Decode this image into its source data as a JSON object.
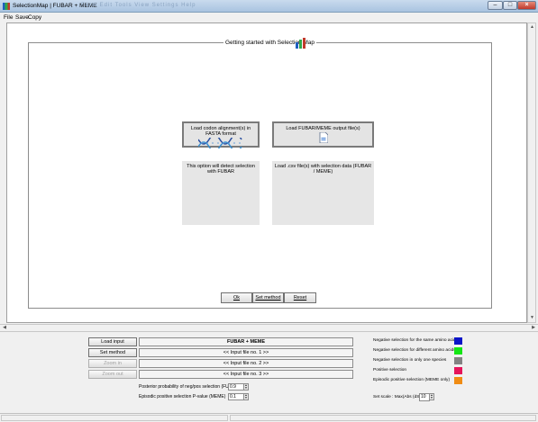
{
  "window": {
    "title": "SelectionMap  |  FUBAR + MEME",
    "ghost_menu": "Form   Edit   Tools   View   Settings   Help"
  },
  "menu": [
    "File",
    "Save",
    "Copy"
  ],
  "main": {
    "group_title": "Getting started with Selection Map",
    "load_codon_label": "Load codon alignment(s) in FASTA format",
    "load_fubar_label": "Load FUBAR/MEME  output file(s)",
    "codon_description": "This option will detect selection with FUBAR",
    "fubar_description": "Load .csv file(s) with selection data (FUBAR / MEME)",
    "ok_label": "Ok",
    "set_method_label": "Set method",
    "reset_label": "Reset"
  },
  "bottom": {
    "buttons": [
      "Load input",
      "Set method",
      "Zoom in",
      "Zoom out"
    ],
    "method_field": "FUBAR + MEME",
    "input_fields": [
      "<< Input file no. 1 >>",
      "<< Input file no. 2 >>",
      "<< Input file no. 3 >>"
    ],
    "posterior_label": "Posterior probability of neg/pos selection (FUBAR)",
    "posterior_value": "0.9",
    "pvalue_label": "Episodic positive selection P-value (MEME)",
    "pvalue_value": "0.1",
    "scale_label": "Set scale : Max(Abs (dS-dN))",
    "scale_value": "10"
  },
  "legend": [
    {
      "label": "Negative selection for the same amino acid",
      "color": "#0a14c8"
    },
    {
      "label": "Negative selection for different amino acids",
      "color": "#14e614"
    },
    {
      "label": "Negative selection in only one species",
      "color": "#828282"
    },
    {
      "label": "Positive selection",
      "color": "#e6145a"
    },
    {
      "label": "Episodic positive selection (MEME only)",
      "color": "#f08c14"
    }
  ]
}
